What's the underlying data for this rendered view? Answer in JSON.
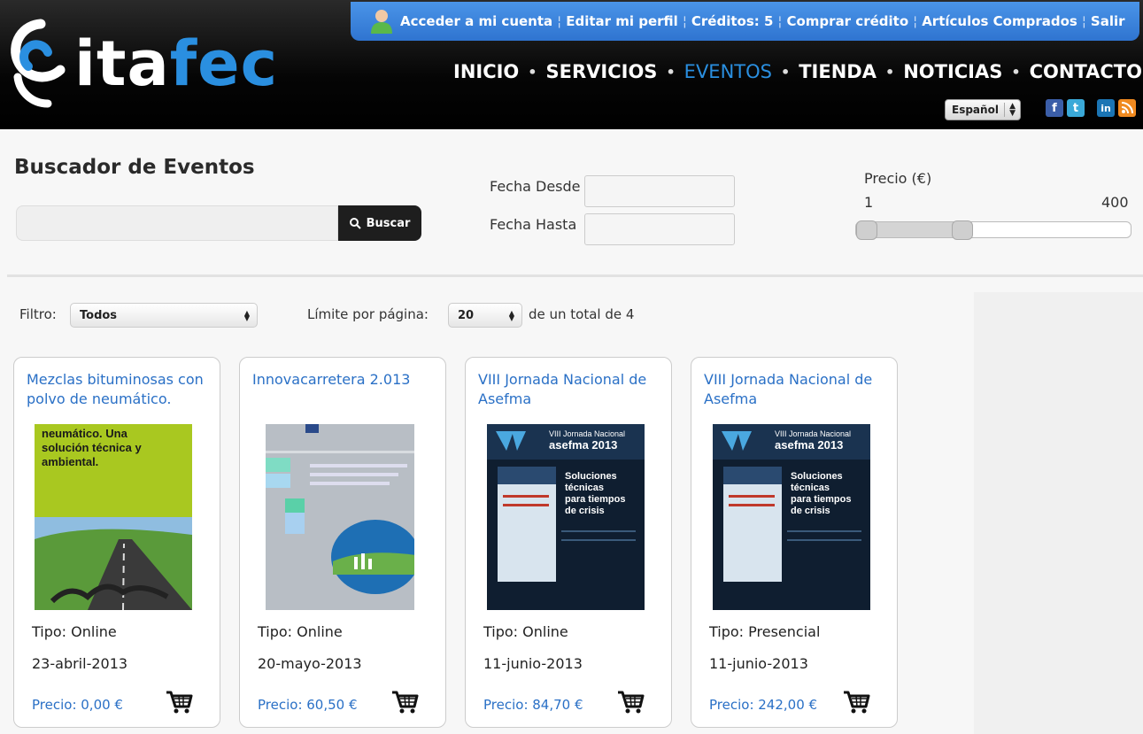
{
  "brand": {
    "logo_text_white": "ita",
    "logo_text_blue": "fec",
    "blue": "#2a8fe0"
  },
  "account_bar": {
    "links": [
      "Acceder a mi cuenta",
      "Editar mi perfil",
      "Créditos: 5",
      "Comprar crédito",
      "Artículos Comprados",
      "Salir"
    ],
    "color": "#3b82dc"
  },
  "nav": {
    "items": [
      "INICIO",
      "SERVICIOS",
      "EVENTOS",
      "TIENDA",
      "NOTICIAS",
      "CONTACTO"
    ],
    "active": "EVENTOS",
    "separator": "•"
  },
  "language": {
    "selected": "Español"
  },
  "social_icons": [
    "facebook-icon",
    "twitter-icon",
    "linkedin-icon",
    "rss-icon"
  ],
  "search": {
    "title": "Buscador de Eventos",
    "input_value": "",
    "button_label": "Buscar",
    "date_from_label": "Fecha Desde",
    "date_to_label": "Fecha Hasta",
    "price_label": "Precio (€)",
    "price_min": "1",
    "price_max": "400",
    "slider": {
      "min": 1,
      "max": 400,
      "low": 1,
      "high": 150
    }
  },
  "filters": {
    "filter_label": "Filtro:",
    "filter_value": "Todos",
    "limit_label": "Límite por página:",
    "limit_value": "20",
    "total_text": "de un total de 4"
  },
  "events": [
    {
      "title": "Mezclas bituminosas con polvo de neumático.",
      "type": "Tipo: Online",
      "date": "23-abril-2013",
      "price": "Precio: 0,00 €",
      "image_text": "neumático. Una solución técnica y ambiental."
    },
    {
      "title": "Innovacarretera 2.013",
      "type": "Tipo: Online",
      "date": "20-mayo-2013",
      "price": "Precio: 60,50 €"
    },
    {
      "title": "VIII Jornada Nacional de Asefma",
      "type": "Tipo: Online",
      "date": "11-junio-2013",
      "price": "Precio: 84,70 €",
      "poster_head": "VIII Jornada Nacional",
      "poster_brand": "asefma 2013",
      "poster_body": "Soluciones técnicas para tiempos de crisis"
    },
    {
      "title": "VIII Jornada Nacional de Asefma",
      "type": "Tipo: Presencial",
      "date": "11-junio-2013",
      "price": "Precio: 242,00 €",
      "poster_head": "VIII Jornada Nacional",
      "poster_brand": "asefma 2013",
      "poster_body": "Soluciones técnicas para tiempos de crisis"
    }
  ]
}
